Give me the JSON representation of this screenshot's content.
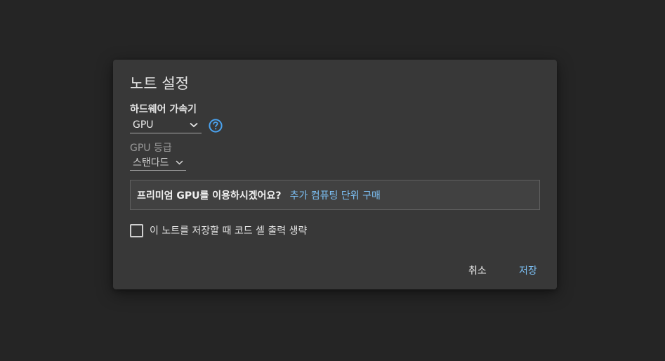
{
  "dialog": {
    "title": "노트 설정",
    "accelerator": {
      "label": "하드웨어 가속기",
      "selected": "GPU"
    },
    "gpu_tier": {
      "label": "GPU 등급",
      "selected": "스탠다드"
    },
    "premium": {
      "question": "프리미엄 GPU를 이용하시겠어요?",
      "link": "추가 컴퓨팅 단위 구매"
    },
    "omit_output": {
      "label": "이 노트를 저장할 때 코드 셀 출력 생략",
      "checked": false
    },
    "buttons": {
      "cancel": "취소",
      "save": "저장"
    }
  },
  "colors": {
    "page_background": "#252525",
    "dialog_background": "#383838",
    "accent": "#7cc0f5",
    "help_icon": "#4aa3f0"
  }
}
